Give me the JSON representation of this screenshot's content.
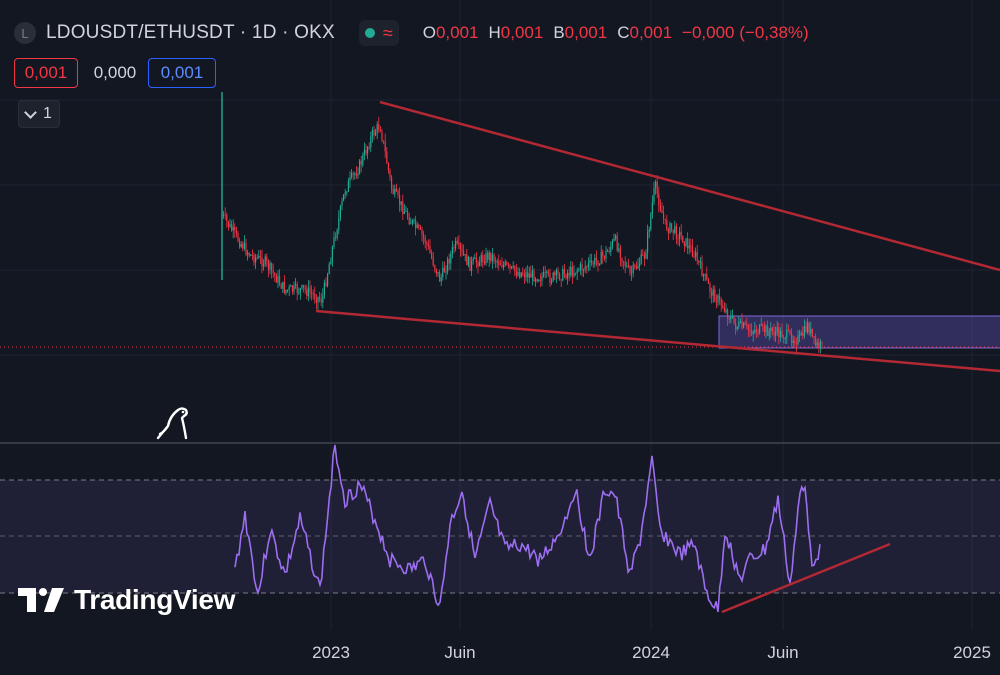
{
  "header": {
    "symbol_badge": "L",
    "symbol_title": "LDOUSDT/ETHUSDT · 1D · OKX",
    "ohlc": {
      "o_label": "O",
      "o_value": "0,001",
      "h_label": "H",
      "h_value": "0,001",
      "b_label": "B",
      "b_value": "0,001",
      "c_label": "C",
      "c_value": "0,001",
      "change": "−0,000 (−0,38%)"
    }
  },
  "trade": {
    "sell_price": "0,001",
    "spread": "0,000",
    "buy_price": "0,001"
  },
  "indicators_toggle": {
    "count": "1"
  },
  "brand": {
    "name": "TradingView"
  },
  "colors": {
    "background": "#131722",
    "up": "#22ab94",
    "down": "#f23645",
    "rsi": "#9c6ef0",
    "trendline": "#b22833",
    "zone": "#6a5acd"
  },
  "icons": [
    "chevron-down-icon",
    "tradingview-logo-icon",
    "dinosaur-icon",
    "live-dot-icon",
    "wave-icon"
  ],
  "chart_data": {
    "type": "candlestick",
    "timeframe": "1D",
    "x_ticks": [
      "2023",
      "Juin",
      "2024",
      "Juin",
      "2025"
    ],
    "price_series_start": "2022-09",
    "price_series_end": "2024-07",
    "rsi_panel": {
      "levels": [
        70,
        50,
        30
      ]
    },
    "drawings": [
      {
        "type": "trendline",
        "from": "2023-03",
        "to": "2025-02",
        "desc": "descending resistance"
      },
      {
        "type": "trendline",
        "from": "2022-11",
        "to": "2025-02",
        "desc": "descending support"
      },
      {
        "type": "rectangle",
        "from": "2024-04",
        "to": "2025-02",
        "desc": "range zone"
      },
      {
        "type": "trendline",
        "panel": "rsi",
        "from": "2024-04",
        "to": "2024-10",
        "desc": "rising rsi support"
      }
    ]
  }
}
